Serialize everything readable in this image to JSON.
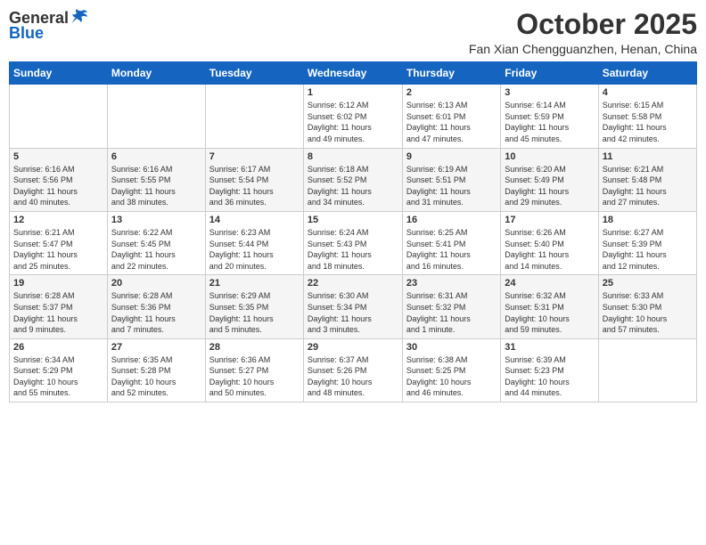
{
  "logo": {
    "general": "General",
    "blue": "Blue"
  },
  "title": "October 2025",
  "location": "Fan Xian Chengguanzhen, Henan, China",
  "days_of_week": [
    "Sunday",
    "Monday",
    "Tuesday",
    "Wednesday",
    "Thursday",
    "Friday",
    "Saturday"
  ],
  "weeks": [
    [
      {
        "day": "",
        "detail": ""
      },
      {
        "day": "",
        "detail": ""
      },
      {
        "day": "",
        "detail": ""
      },
      {
        "day": "1",
        "detail": "Sunrise: 6:12 AM\nSunset: 6:02 PM\nDaylight: 11 hours\nand 49 minutes."
      },
      {
        "day": "2",
        "detail": "Sunrise: 6:13 AM\nSunset: 6:01 PM\nDaylight: 11 hours\nand 47 minutes."
      },
      {
        "day": "3",
        "detail": "Sunrise: 6:14 AM\nSunset: 5:59 PM\nDaylight: 11 hours\nand 45 minutes."
      },
      {
        "day": "4",
        "detail": "Sunrise: 6:15 AM\nSunset: 5:58 PM\nDaylight: 11 hours\nand 42 minutes."
      }
    ],
    [
      {
        "day": "5",
        "detail": "Sunrise: 6:16 AM\nSunset: 5:56 PM\nDaylight: 11 hours\nand 40 minutes."
      },
      {
        "day": "6",
        "detail": "Sunrise: 6:16 AM\nSunset: 5:55 PM\nDaylight: 11 hours\nand 38 minutes."
      },
      {
        "day": "7",
        "detail": "Sunrise: 6:17 AM\nSunset: 5:54 PM\nDaylight: 11 hours\nand 36 minutes."
      },
      {
        "day": "8",
        "detail": "Sunrise: 6:18 AM\nSunset: 5:52 PM\nDaylight: 11 hours\nand 34 minutes."
      },
      {
        "day": "9",
        "detail": "Sunrise: 6:19 AM\nSunset: 5:51 PM\nDaylight: 11 hours\nand 31 minutes."
      },
      {
        "day": "10",
        "detail": "Sunrise: 6:20 AM\nSunset: 5:49 PM\nDaylight: 11 hours\nand 29 minutes."
      },
      {
        "day": "11",
        "detail": "Sunrise: 6:21 AM\nSunset: 5:48 PM\nDaylight: 11 hours\nand 27 minutes."
      }
    ],
    [
      {
        "day": "12",
        "detail": "Sunrise: 6:21 AM\nSunset: 5:47 PM\nDaylight: 11 hours\nand 25 minutes."
      },
      {
        "day": "13",
        "detail": "Sunrise: 6:22 AM\nSunset: 5:45 PM\nDaylight: 11 hours\nand 22 minutes."
      },
      {
        "day": "14",
        "detail": "Sunrise: 6:23 AM\nSunset: 5:44 PM\nDaylight: 11 hours\nand 20 minutes."
      },
      {
        "day": "15",
        "detail": "Sunrise: 6:24 AM\nSunset: 5:43 PM\nDaylight: 11 hours\nand 18 minutes."
      },
      {
        "day": "16",
        "detail": "Sunrise: 6:25 AM\nSunset: 5:41 PM\nDaylight: 11 hours\nand 16 minutes."
      },
      {
        "day": "17",
        "detail": "Sunrise: 6:26 AM\nSunset: 5:40 PM\nDaylight: 11 hours\nand 14 minutes."
      },
      {
        "day": "18",
        "detail": "Sunrise: 6:27 AM\nSunset: 5:39 PM\nDaylight: 11 hours\nand 12 minutes."
      }
    ],
    [
      {
        "day": "19",
        "detail": "Sunrise: 6:28 AM\nSunset: 5:37 PM\nDaylight: 11 hours\nand 9 minutes."
      },
      {
        "day": "20",
        "detail": "Sunrise: 6:28 AM\nSunset: 5:36 PM\nDaylight: 11 hours\nand 7 minutes."
      },
      {
        "day": "21",
        "detail": "Sunrise: 6:29 AM\nSunset: 5:35 PM\nDaylight: 11 hours\nand 5 minutes."
      },
      {
        "day": "22",
        "detail": "Sunrise: 6:30 AM\nSunset: 5:34 PM\nDaylight: 11 hours\nand 3 minutes."
      },
      {
        "day": "23",
        "detail": "Sunrise: 6:31 AM\nSunset: 5:32 PM\nDaylight: 11 hours\nand 1 minute."
      },
      {
        "day": "24",
        "detail": "Sunrise: 6:32 AM\nSunset: 5:31 PM\nDaylight: 10 hours\nand 59 minutes."
      },
      {
        "day": "25",
        "detail": "Sunrise: 6:33 AM\nSunset: 5:30 PM\nDaylight: 10 hours\nand 57 minutes."
      }
    ],
    [
      {
        "day": "26",
        "detail": "Sunrise: 6:34 AM\nSunset: 5:29 PM\nDaylight: 10 hours\nand 55 minutes."
      },
      {
        "day": "27",
        "detail": "Sunrise: 6:35 AM\nSunset: 5:28 PM\nDaylight: 10 hours\nand 52 minutes."
      },
      {
        "day": "28",
        "detail": "Sunrise: 6:36 AM\nSunset: 5:27 PM\nDaylight: 10 hours\nand 50 minutes."
      },
      {
        "day": "29",
        "detail": "Sunrise: 6:37 AM\nSunset: 5:26 PM\nDaylight: 10 hours\nand 48 minutes."
      },
      {
        "day": "30",
        "detail": "Sunrise: 6:38 AM\nSunset: 5:25 PM\nDaylight: 10 hours\nand 46 minutes."
      },
      {
        "day": "31",
        "detail": "Sunrise: 6:39 AM\nSunset: 5:23 PM\nDaylight: 10 hours\nand 44 minutes."
      },
      {
        "day": "",
        "detail": ""
      }
    ]
  ]
}
